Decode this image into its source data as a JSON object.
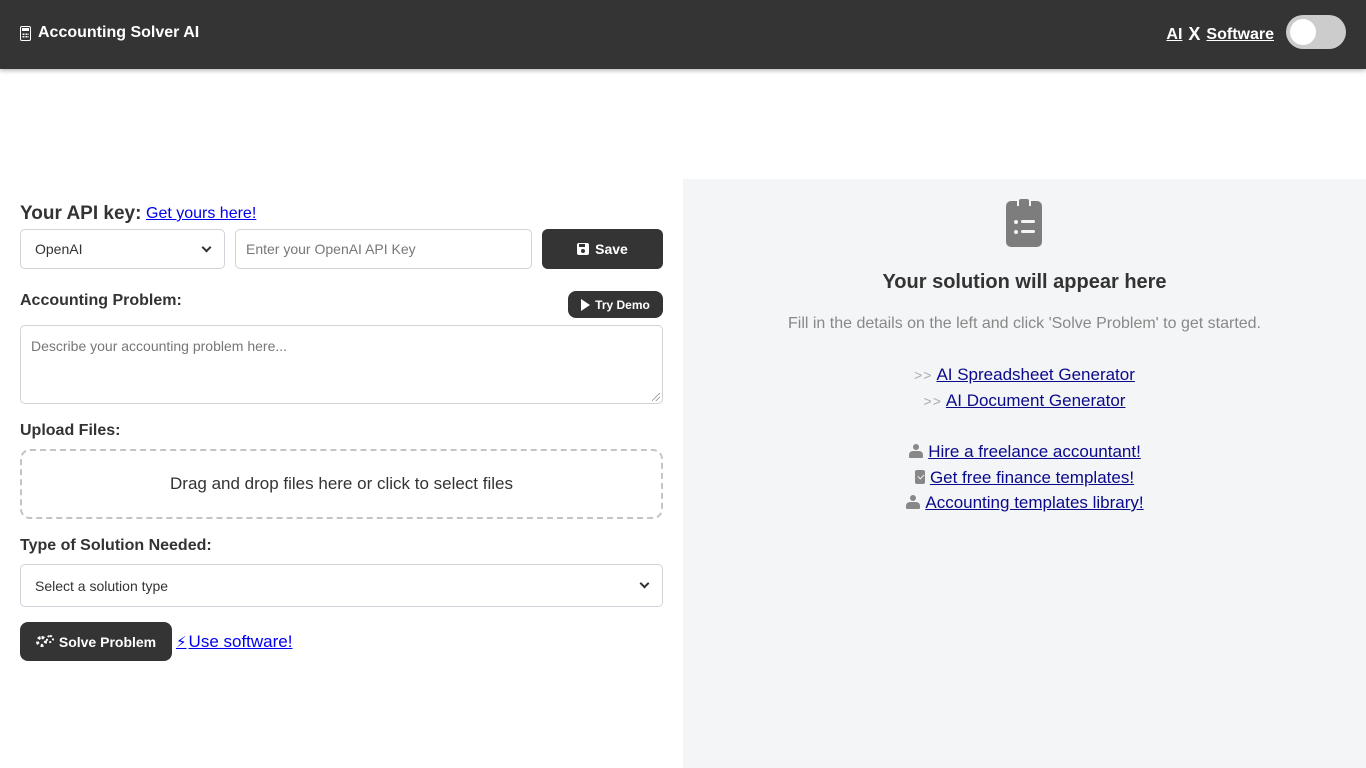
{
  "header": {
    "brand": "Accounting Solver AI",
    "link_ai": "AI",
    "separator": "X",
    "link_software": "Software",
    "toggle_on": false
  },
  "api": {
    "label": "Your API key:",
    "get_link": "Get yours here!",
    "provider": "OpenAI",
    "key_placeholder": "Enter your OpenAI API Key",
    "save_label": "Save"
  },
  "problem": {
    "label": "Accounting Problem:",
    "demo_label": "Try Demo",
    "placeholder": "Describe your accounting problem here..."
  },
  "upload": {
    "label": "Upload Files:",
    "dropzone_text": "Drag and drop files here or click to select files"
  },
  "solution_type": {
    "label": "Type of Solution Needed:",
    "selected": "Select a solution type"
  },
  "actions": {
    "solve_label": "Solve Problem",
    "software_link": "Use software!"
  },
  "result": {
    "title": "Your solution will appear here",
    "subtitle": "Fill in the details on the left and click 'Solve Problem' to get started.",
    "prefix": ">>",
    "tool_links": [
      "AI Spreadsheet Generator",
      "AI Document Generator"
    ],
    "resource_links": [
      "Hire a freelance accountant!",
      "Get free finance templates!",
      "Accounting templates library!"
    ]
  },
  "colors": {
    "header_bg": "#343434",
    "button_bg": "#343434",
    "panel_bg": "#f4f5f7",
    "link": "#0000ee"
  }
}
